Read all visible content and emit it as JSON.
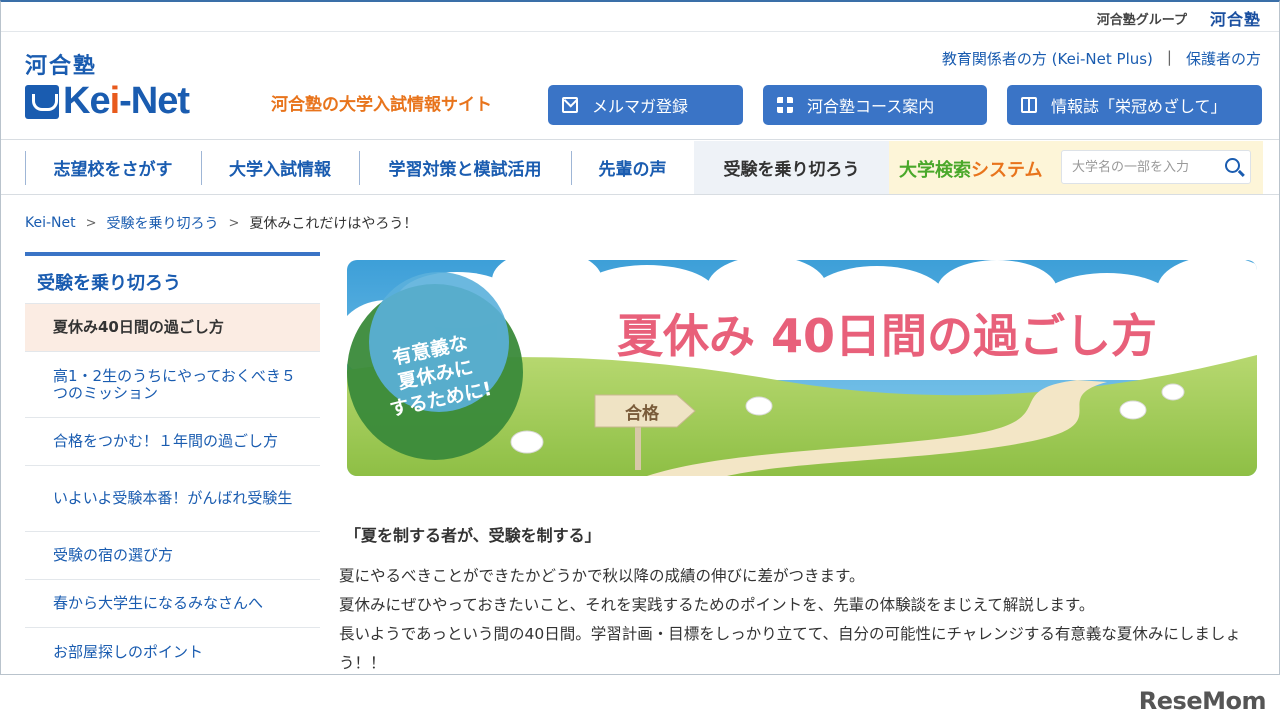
{
  "topbar": {
    "group_label": "河合塾グループ",
    "group_logo": "河合塾"
  },
  "header": {
    "logo_kawai": "河合塾",
    "logo_keinet_a": "Ke",
    "logo_keinet_b": "i",
    "logo_keinet_c": "-Net",
    "tagline": "河合塾の大学入試情報サイト",
    "util_link_1": "教育関係者の方 (Kei-Net Plus)",
    "util_sep": "|",
    "util_link_2": "保護者の方",
    "buttons": [
      {
        "label": "メルマガ登録",
        "icon": "mail-icon"
      },
      {
        "label": "河合塾コース案内",
        "icon": "grid-icon"
      },
      {
        "label": "情報誌「栄冠めざして」",
        "icon": "book-icon"
      }
    ]
  },
  "nav": {
    "items": [
      "志望校をさがす",
      "大学入試情報",
      "学習対策と模試活用",
      "先輩の声",
      "受験を乗り切ろう"
    ],
    "search_title_a": "大学検索",
    "search_title_b": "システム",
    "search_placeholder": "大学名の一部を入力"
  },
  "breadcrumb": {
    "items": [
      "Kei-Net",
      "受験を乗り切ろう"
    ],
    "current": "夏休みこれだけはやろう！"
  },
  "sidebar": {
    "title": "受験を乗り切ろう",
    "items": [
      "夏休み40日間の過ごし方",
      "高1・2生のうちにやっておくべき５つのミッション",
      "合格をつかむ！１年間の過ごし方",
      "いよいよ受験本番！がんばれ受験生",
      "受験の宿の選び方",
      "春から大学生になるみなさんへ",
      "お部屋探しのポイント"
    ]
  },
  "banner": {
    "title": "夏休み 40日間の過ごし方",
    "badge_line1": "有意義な",
    "badge_line2": "夏休みに",
    "badge_line3": "するために!",
    "sign": "合格"
  },
  "main": {
    "lead": "「夏を制する者が、受験を制する」",
    "paragraphs": [
      "夏にやるべきことができたかどうかで秋以降の成績の伸びに差がつきます。",
      "夏休みにぜひやっておきたいこと、それを実践するためのポイントを、先輩の体験談をまじえて解説します。",
      "長いようであっという間の40日間。学習計画・目標をしっかり立てて、自分の可能性にチャレンジする有意義な夏休みにしましょう！！"
    ]
  },
  "watermark": "ReseMom"
}
